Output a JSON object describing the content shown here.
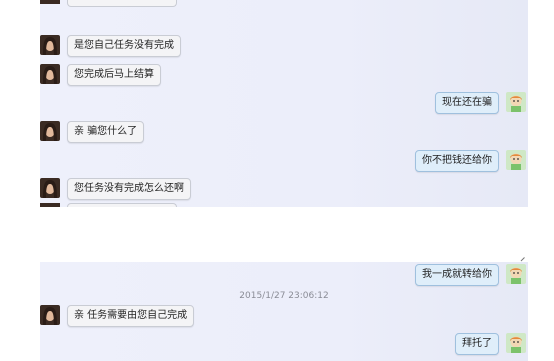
{
  "chat": {
    "messages_top": [
      {
        "side": "left",
        "text": "是您自己任务没有完成"
      },
      {
        "side": "left",
        "text": "您完成后马上结算"
      },
      {
        "side": "right",
        "text": "现在还在骗"
      },
      {
        "side": "left",
        "text": "亲 骗您什么了"
      },
      {
        "side": "right",
        "text": "你不把钱还给你"
      },
      {
        "side": "left",
        "text": "您任务没有完成怎么还啊"
      }
    ],
    "messages_bottom": [
      {
        "side": "right",
        "text": "我一成就转给你"
      },
      {
        "side": "left",
        "text": "亲 任务需要由您自己完成"
      },
      {
        "side": "right",
        "text": "拜托了"
      }
    ],
    "timestamp": "2015/1/27 23:06:12"
  },
  "icons": {
    "left_avatar": "female-user-avatar-icon",
    "right_avatar": "cartoon-user-avatar-icon"
  },
  "colors": {
    "panel_bg": "#eceefa",
    "bubble_left_bg": "#f4f4f6",
    "bubble_right_bg": "#dfeefa",
    "bubble_right_border": "#9fc0de"
  }
}
